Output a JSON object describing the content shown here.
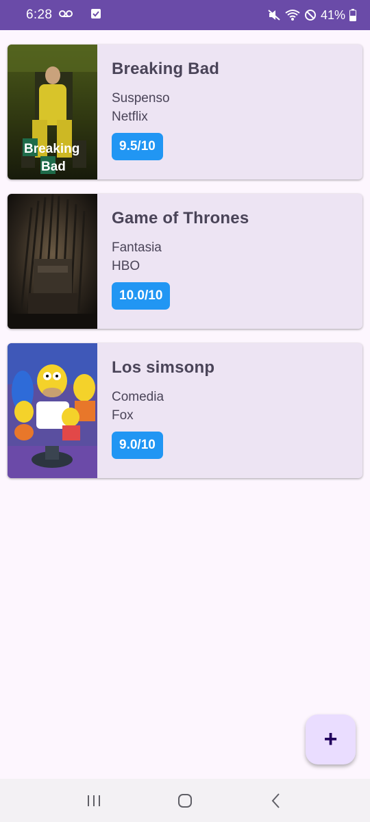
{
  "status_bar": {
    "time": "6:28",
    "battery": "41%",
    "icons": [
      "voicemail-icon",
      "check-notification-icon",
      "mute-icon",
      "wifi-icon",
      "do-not-disturb-icon",
      "battery-icon"
    ]
  },
  "series": [
    {
      "title": "Breaking Bad",
      "genre": "Suspenso",
      "network": "Netflix",
      "rating": "9.5/10",
      "poster_text_line1": "Breaking",
      "poster_text_line2": "Bad"
    },
    {
      "title": "Game of Thrones",
      "genre": "Fantasia",
      "network": "HBO",
      "rating": "10.0/10"
    },
    {
      "title": "Los simsonp",
      "genre": "Comedia",
      "network": "Fox",
      "rating": "9.0/10"
    }
  ],
  "fab": {
    "label": "+"
  },
  "nav": {
    "icons": [
      "recent-apps-icon",
      "home-icon",
      "back-icon"
    ]
  },
  "colors": {
    "status_bar": "#6a4ba8",
    "card_bg": "#ede4f3",
    "badge": "#2196f3",
    "fab": "#eaddff",
    "background": "#fdf6fe"
  }
}
